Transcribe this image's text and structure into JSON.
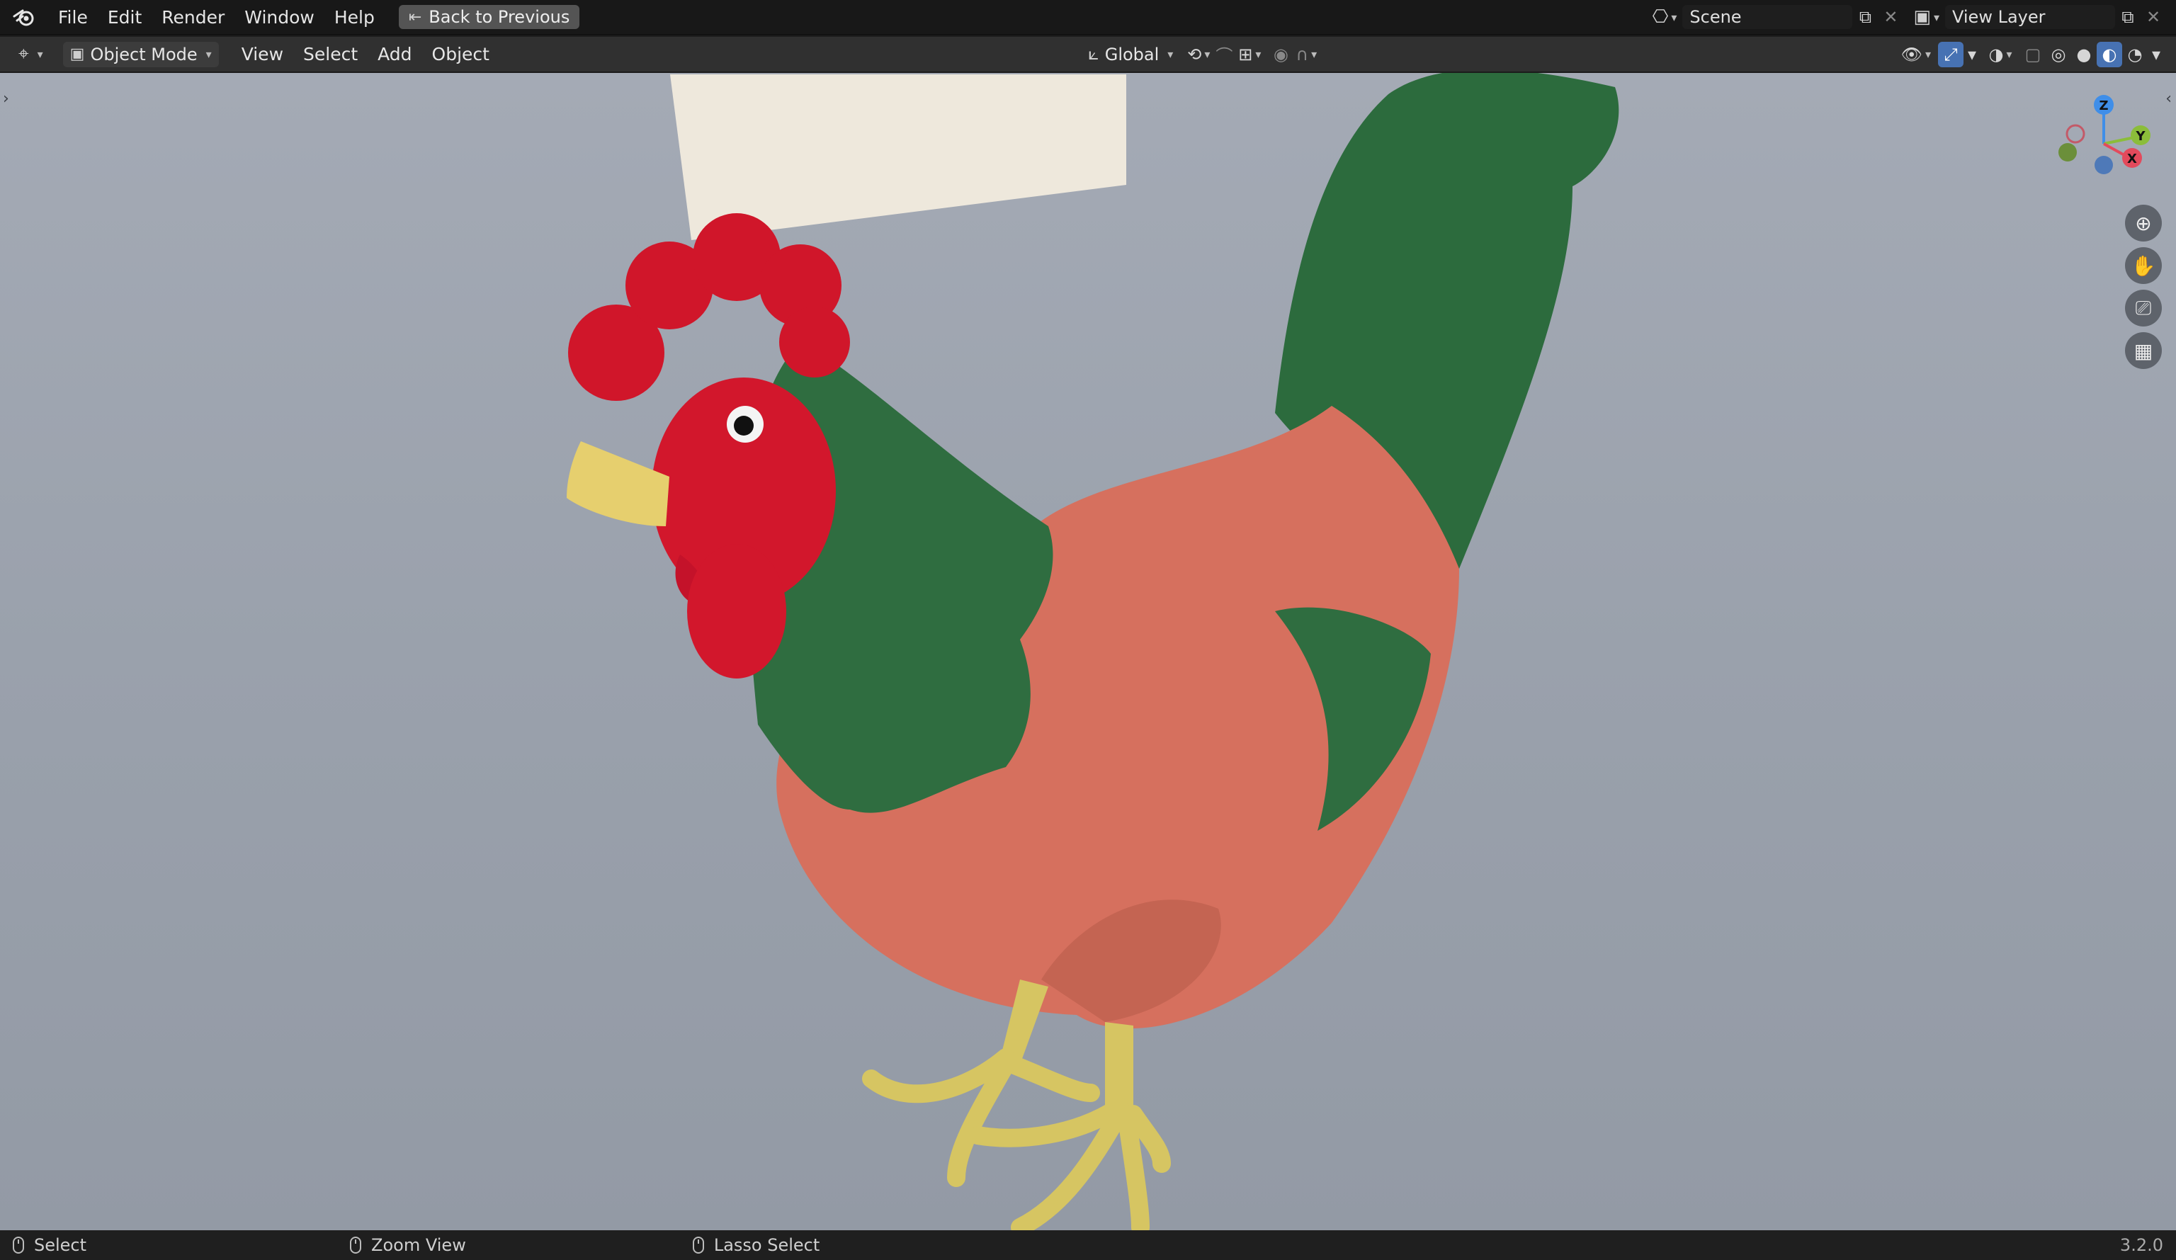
{
  "menubar": {
    "items": [
      "File",
      "Edit",
      "Render",
      "Window",
      "Help"
    ],
    "back_button": "Back to Previous",
    "scene": "Scene",
    "view_layer": "View Layer"
  },
  "header": {
    "mode": "Object Mode",
    "menus": [
      "View",
      "Select",
      "Add",
      "Object"
    ],
    "transform_orientation": "Global"
  },
  "statusbar": {
    "select": "Select",
    "zoom": "Zoom View",
    "lasso": "Lasso Select",
    "version": "3.2.0"
  },
  "gizmo": {
    "z": "Z",
    "y": "Y",
    "x": "X"
  },
  "colors": {
    "accent": "#4772b3",
    "axis_x": "#e34a5c",
    "axis_y": "#8bbd3a",
    "axis_z": "#3f8ee8"
  }
}
